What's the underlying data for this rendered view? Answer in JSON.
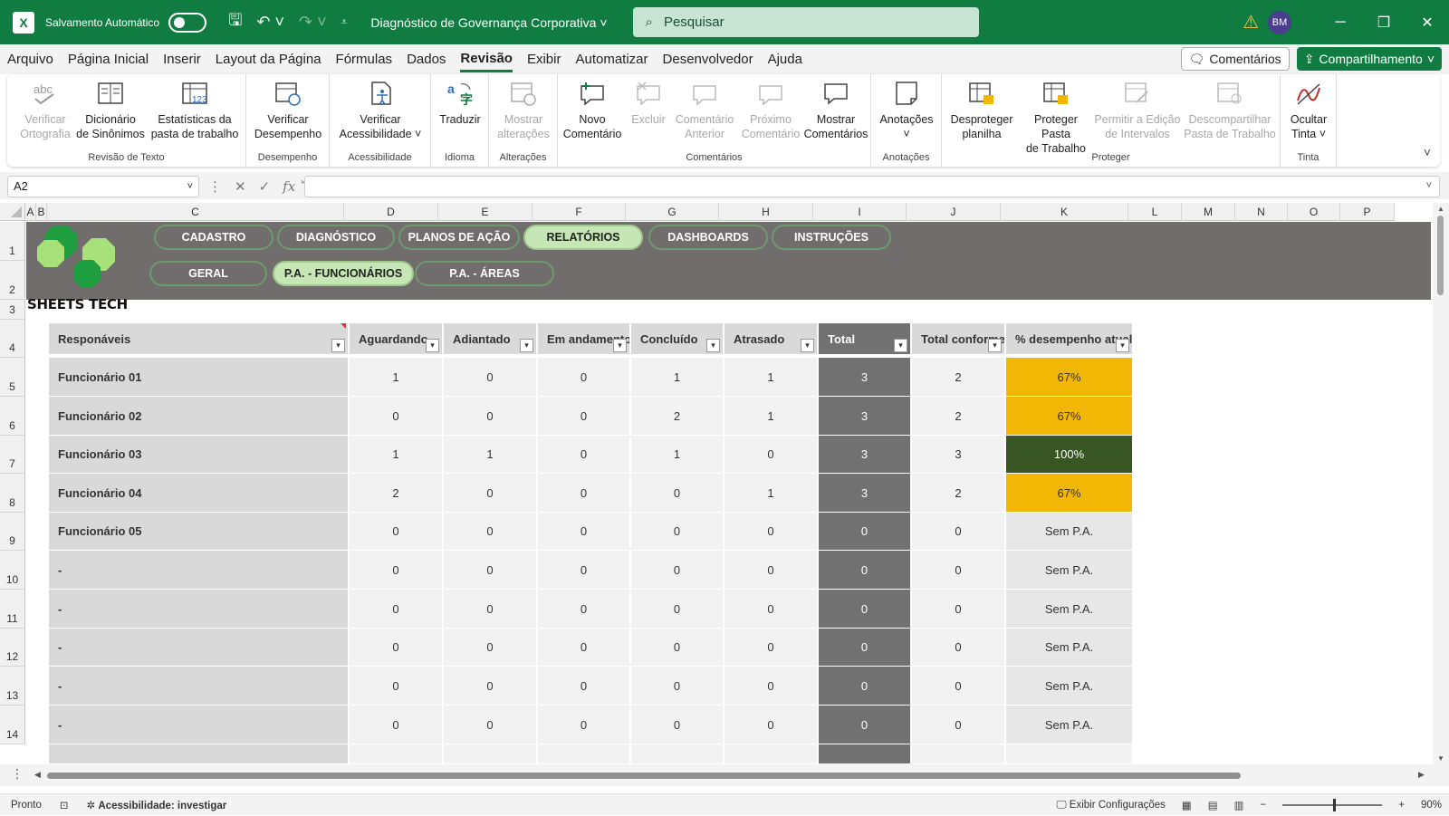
{
  "titlebar": {
    "autosave_label": "Salvamento Automático",
    "doc_title": "Diagnóstico de Governança Corporativa",
    "search_placeholder": "Pesquisar",
    "avatar": "BM"
  },
  "menu": [
    "Arquivo",
    "Página Inicial",
    "Inserir",
    "Layout da Página",
    "Fórmulas",
    "Dados",
    "Revisão",
    "Exibir",
    "Automatizar",
    "Desenvolvedor",
    "Ajuda"
  ],
  "menu_active": "Revisão",
  "menu_buttons": {
    "comments": "Comentários",
    "share": "Compartilhamento"
  },
  "ribbon": {
    "groups": {
      "proofing": "Revisão de Texto",
      "performance": "Desempenho",
      "accessibility": "Acessibilidade",
      "language": "Idioma",
      "changes": "Alterações",
      "comments": "Comentários",
      "notes": "Anotações",
      "protect": "Proteger",
      "ink": "Tinta"
    },
    "buttons": {
      "spelling": [
        "Verificar",
        "Ortografia"
      ],
      "thesaurus": [
        "Dicionário",
        "de Sinônimos"
      ],
      "stats": [
        "Estatísticas da",
        "pasta de trabalho"
      ],
      "check_perf": [
        "Verificar",
        "Desempenho"
      ],
      "check_access": [
        "Verificar",
        "Acessibilidade ˅"
      ],
      "translate": [
        "Traduzir",
        ""
      ],
      "show_changes": [
        "Mostrar",
        "alterações"
      ],
      "new_comment": [
        "Novo",
        "Comentário"
      ],
      "delete": [
        "Excluir",
        ""
      ],
      "prev_comment": [
        "Comentário",
        "Anterior"
      ],
      "next_comment": [
        "Próximo",
        "Comentário"
      ],
      "show_comments": [
        "Mostrar",
        "Comentários"
      ],
      "notes": [
        "Anotações",
        "˅"
      ],
      "unprotect": [
        "Desproteger",
        "planilha"
      ],
      "protect_wb": [
        "Proteger Pasta",
        "de Trabalho"
      ],
      "allow_edit": [
        "Permitir a Edição",
        "de Intervalos"
      ],
      "unshare": [
        "Descompartilhar",
        "Pasta de Trabalho"
      ],
      "hide_ink": [
        "Ocultar",
        "Tinta ˅"
      ]
    }
  },
  "formula_bar": {
    "name_box": "A2",
    "formula": ""
  },
  "columns": [
    "A",
    "B",
    "C",
    "D",
    "E",
    "F",
    "G",
    "H",
    "I",
    "J",
    "K",
    "L",
    "M",
    "N",
    "O",
    "P"
  ],
  "rows": [
    "1",
    "2",
    "3",
    "4",
    "5",
    "6",
    "7",
    "8",
    "9",
    "10",
    "11",
    "12",
    "13",
    "14"
  ],
  "nav_top": [
    "CADASTRO",
    "DIAGNÓSTICO",
    "PLANOS DE AÇÃO",
    "RELATÓRIOS",
    "DASHBOARDS",
    "INSTRUÇÕES"
  ],
  "nav_top_active": 3,
  "nav_sub": [
    "GERAL",
    "P.A. - FUNCIONÁRIOS",
    "P.A. - ÁREAS"
  ],
  "nav_sub_active": 1,
  "brand": "SHEETS TECH",
  "table": {
    "headers": [
      "Responáveis",
      "Aguardando",
      "Adiantado",
      "Em andamento",
      "Concluído",
      "Atrasado",
      "Total",
      "Total conforme",
      "% desempenho atual"
    ],
    "rows": [
      [
        "Funcionário 01",
        "1",
        "0",
        "0",
        "1",
        "1",
        "3",
        "2",
        "67%"
      ],
      [
        "Funcionário 02",
        "0",
        "0",
        "0",
        "2",
        "1",
        "3",
        "2",
        "67%"
      ],
      [
        "Funcionário 03",
        "1",
        "1",
        "0",
        "1",
        "0",
        "3",
        "3",
        "100%"
      ],
      [
        "Funcionário 04",
        "2",
        "0",
        "0",
        "0",
        "1",
        "3",
        "2",
        "67%"
      ],
      [
        "Funcionário 05",
        "0",
        "0",
        "0",
        "0",
        "0",
        "0",
        "0",
        "Sem P.A."
      ],
      [
        "-",
        "0",
        "0",
        "0",
        "0",
        "0",
        "0",
        "0",
        "Sem P.A."
      ],
      [
        "-",
        "0",
        "0",
        "0",
        "0",
        "0",
        "0",
        "0",
        "Sem P.A."
      ],
      [
        "-",
        "0",
        "0",
        "0",
        "0",
        "0",
        "0",
        "0",
        "Sem P.A."
      ],
      [
        "-",
        "0",
        "0",
        "0",
        "0",
        "0",
        "0",
        "0",
        "Sem P.A."
      ],
      [
        "-",
        "0",
        "0",
        "0",
        "0",
        "0",
        "0",
        "0",
        "Sem P.A."
      ]
    ]
  },
  "colors": {
    "excel_green": "#107c41",
    "perf_warn": "#f2b705",
    "perf_ok": "#375623",
    "banner": "#716d6d",
    "nav_active": "#c6e6b5"
  },
  "status": {
    "ready": "Pronto",
    "accessibility": "Acessibilidade: investigar",
    "display_settings": "Exibir Configurações",
    "zoom": "90%"
  }
}
